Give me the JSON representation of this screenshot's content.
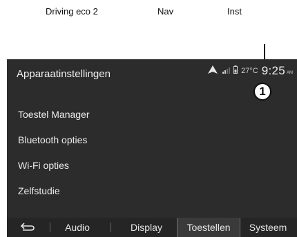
{
  "top_tabs": [
    "Driving eco 2",
    "Nav",
    "Inst"
  ],
  "callout_number": "1",
  "header": {
    "title": "Apparaatinstellingen",
    "temperature": "27°C",
    "time": "9:25",
    "ampm": "AM"
  },
  "menu": {
    "items": [
      {
        "label": "Toestel Manager"
      },
      {
        "label": "Bluetooth opties"
      },
      {
        "label": "Wi-Fi opties"
      },
      {
        "label": "Zelfstudie"
      }
    ]
  },
  "tabs": {
    "back_icon": "back-icon",
    "items": [
      {
        "label": "Audio"
      },
      {
        "label": "Display"
      },
      {
        "label": "Toestellen",
        "active": true
      },
      {
        "label": "Systeem"
      }
    ]
  },
  "colors": {
    "screen_bg": "#2c2c2c",
    "tabbar_bg": "#252525",
    "active_tab_bg": "#3a3a3a",
    "text": "#e8e8e8"
  }
}
